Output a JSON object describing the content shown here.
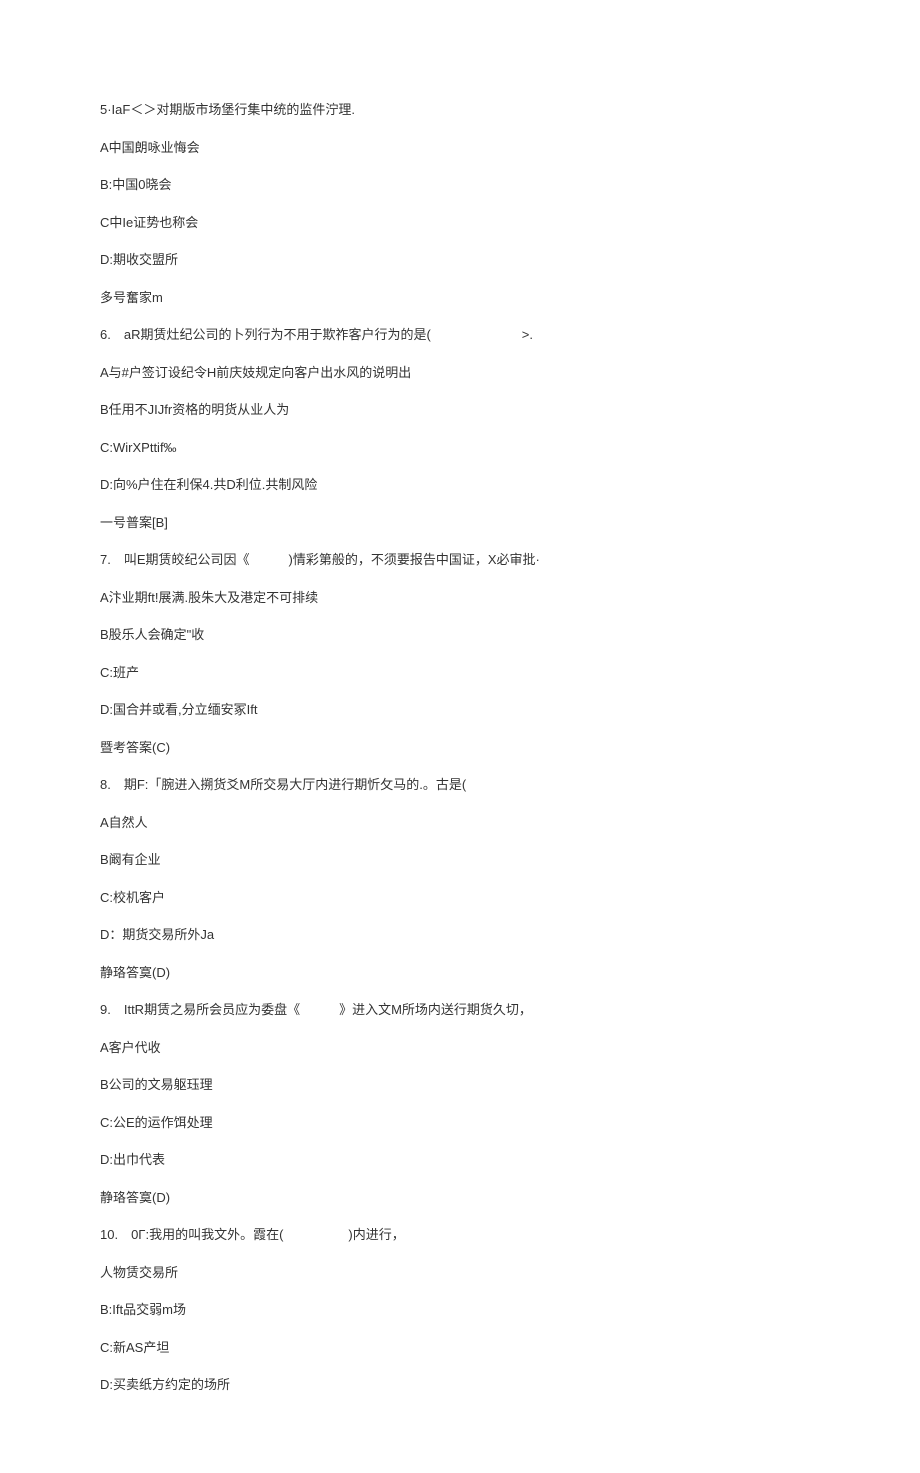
{
  "q5": {
    "header": "5·IaF＜＞对期版市场堡行集中统的监件泞理.",
    "optA": "A中国朗咏业悔会",
    "optB": "B:中国0晓会",
    "optC": "C中Ie证势也称会",
    "optD": "D:期收交盟所",
    "answer": "多号奮家m"
  },
  "q6": {
    "header": "6.　aR期赁灶纪公司的卜列行为不用于欺祚客户行为的是(　　　　　　　>.",
    "optA": "A与#户签订设纪令H前庆妓规定向客户出水风的说明出",
    "optB": "B任用不JIJfr资格的明货从业人为",
    "optC": "C:WirXPttif‰",
    "optD": "D:向%户住在利保4.共D利位.共制风险",
    "answer": "一号普案[B]"
  },
  "q7": {
    "header": "7.　叫E期赁皎纪公司因《　　　)情彩第般的，不须要报告中国证，X必审批·",
    "optA": "A汴业期ft!展满.股朱大及港定不可排续",
    "optB": "B股乐人会确定\"收",
    "optC": "C:班产",
    "optD": "D:国合并或看,分立缅安冢Ift",
    "answer": "暨考答案(C)"
  },
  "q8": {
    "header": "8.　期F:「腕进入搠货爻M所交易大厅内进行期忻攵马的.。古是(",
    "optA": "A自然人",
    "optB": "B阚有企业",
    "optC": "C:校机客户",
    "optD": "D：期货交易所外Ja",
    "answer": "静珞答寞(D)"
  },
  "q9": {
    "header": "9.　IttR期赁之易所会员应为委盘《　　　》进入文M所场内送行期货久切，",
    "optA": "A客户代收",
    "optB": "B公司的文易躯珏理",
    "optC": "C:公E的运作饵处理",
    "optD": "D:出巾代表",
    "answer": "静珞答寞(D)"
  },
  "q10": {
    "header": "10.　0Γ:我用的叫我文外。霞在(　　　　　)内进行，",
    "optA": "人物赁交易所",
    "optB": "B:Ift品交弱m场",
    "optC": "C:新AS产坦",
    "optD": "D:买卖纸方约定的场所"
  }
}
